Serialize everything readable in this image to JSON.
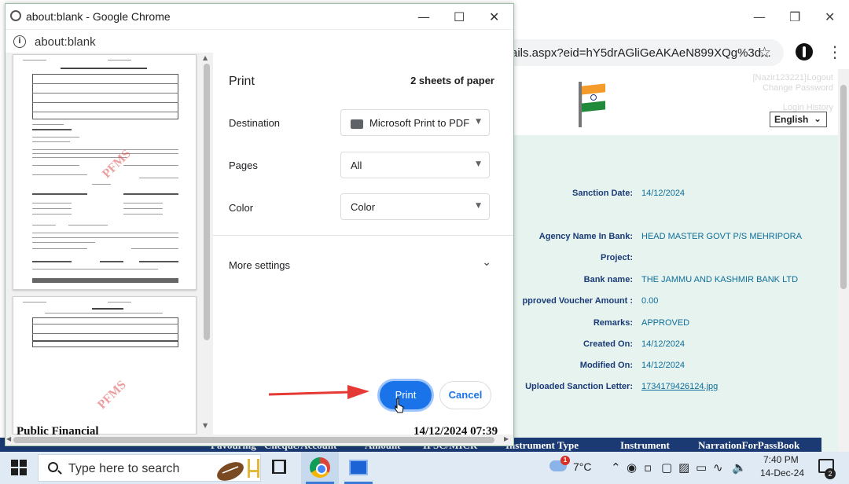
{
  "bg_browser": {
    "url_partial": "ails.aspx?eid=hY5drAGliGeAKAeN899XQg%3d...",
    "header_user": "[Nazir123221]",
    "header_logout": "Logout",
    "header_change_password": "Change Password",
    "header_login_history": "Login History",
    "language_selected": "English",
    "fields": [
      {
        "label": "Sanction Date:",
        "value": "14/12/2024"
      },
      {
        "label": "Agency Name In Bank:",
        "value": "HEAD MASTER GOVT P/S MEHRIPORA"
      },
      {
        "label": "Project:",
        "value": ""
      },
      {
        "label": "Bank name:",
        "value": "THE JAMMU AND KASHMIR BANK LTD"
      },
      {
        "label": "pproved Voucher Amount :",
        "value": "0.00"
      },
      {
        "label": "Remarks:",
        "value": "APPROVED"
      },
      {
        "label": "Created On:",
        "value": "14/12/2024"
      },
      {
        "label": "Modified On:",
        "value": "14/12/2024"
      },
      {
        "label": "Uploaded Sanction Letter:",
        "value": "1734179426124.jpg"
      }
    ],
    "table_headers": [
      "Favouring",
      "Cheque/Account",
      "Amount",
      "IFSC/MICR",
      "Instrument Type",
      "Instrument",
      "NarrationForPassBook"
    ]
  },
  "popup": {
    "window_title": "about:blank - Google Chrome",
    "address": "about:blank",
    "preview_watermark": "PFMS",
    "behind_text_left": "Public Financial",
    "behind_text_right": "14/12/2024 07:39"
  },
  "print": {
    "title": "Print",
    "sheets": "2 sheets of paper",
    "destination_label": "Destination",
    "destination_value": "Microsoft Print to PDF",
    "pages_label": "Pages",
    "pages_value": "All",
    "color_label": "Color",
    "color_value": "Color",
    "more_settings": "More settings",
    "print_button": "Print",
    "cancel_button": "Cancel"
  },
  "taskbar": {
    "search_placeholder": "Type here to search",
    "weather_badge": "1",
    "temperature": "7°C",
    "time": "7:40 PM",
    "date": "14-Dec-24",
    "notification_count": "2"
  },
  "icons": [
    "window-minimize-icon",
    "window-maximize-icon",
    "window-close-icon",
    "star-icon",
    "extension-icon",
    "kebab-menu-icon",
    "globe-icon",
    "info-icon",
    "printer-icon",
    "caret-down-icon",
    "chevron-down-icon",
    "windows-start-icon",
    "search-icon",
    "task-view-icon",
    "chrome-icon",
    "weather-icon",
    "notification-icon"
  ],
  "colors": {
    "accent": "#1a73e8",
    "field_label": "#1a3b78",
    "field_value": "#0e6e9a",
    "table_header": "#1b3a73",
    "arrow": "#e53935"
  }
}
